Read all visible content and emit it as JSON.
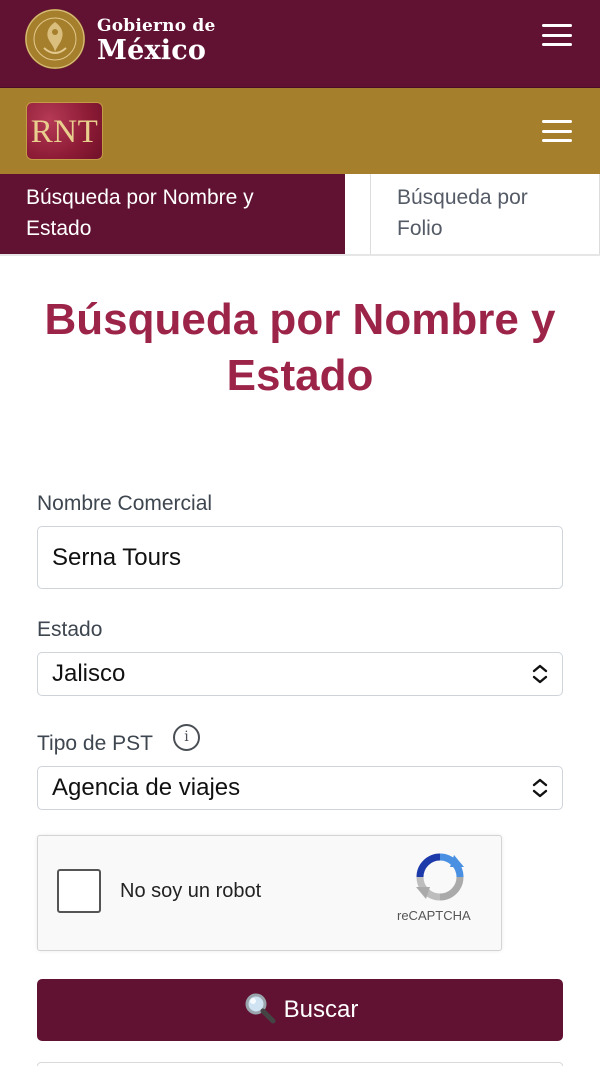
{
  "gov_header": {
    "title_line1": "Gobierno de",
    "title_line2": "México",
    "seal_text": "ESTADOS UNIDOS MEXICANOS",
    "seal_icon": "mexico-seal-icon",
    "menu_icon": "hamburger-menu-icon"
  },
  "rnt_header": {
    "logo_text": "RNT",
    "menu_icon": "hamburger-menu-icon"
  },
  "tabs": [
    {
      "label": "Búsqueda por Nombre y Estado",
      "active": true
    },
    {
      "label": "Búsqueda por Folio",
      "active": false
    }
  ],
  "form": {
    "title": "Búsqueda por Nombre y Estado",
    "nombre_label": "Nombre Comercial",
    "nombre_value": "Serna Tours",
    "estado_label": "Estado",
    "estado_value": "Jalisco",
    "tipo_label": "Tipo de PST",
    "tipo_info_icon": "info-icon",
    "tipo_value": "Agencia de viajes"
  },
  "recaptcha": {
    "label": "No soy un robot",
    "brand": "reCAPTCHA",
    "checked": false
  },
  "search_button": {
    "label": "Buscar",
    "icon": "magnifying-glass-icon"
  },
  "colors": {
    "guinda": "#611232",
    "gold": "#a57f2c",
    "title": "#9d2449"
  }
}
